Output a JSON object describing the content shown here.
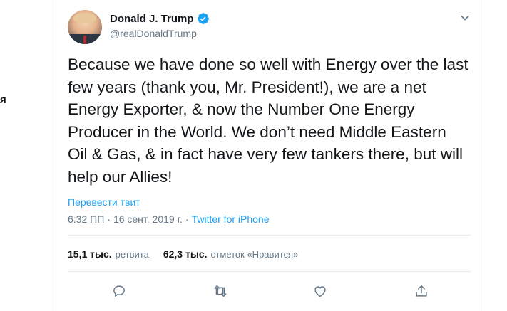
{
  "side": {
    "cropped_text": "я"
  },
  "tweet": {
    "author": {
      "name": "Donald J. Trump",
      "handle": "@realDonaldTrump",
      "verified_icon": "verified-badge-icon"
    },
    "text": "Because we have done so well with Energy over the last\nfew years (thank you, Mr. President!), we are a net\nEnergy Exporter, & now the Number One Energy\nProducer in the World. We don’t need Middle Eastern\nOil & Gas, & in fact have very few tankers there, but will\nhelp our Allies!",
    "translate_label": "Перевести твит",
    "time": "6:32 ПП",
    "date": "16 сент. 2019 г.",
    "separator": "·",
    "source": "Twitter for iPhone",
    "stats": {
      "retweets_count": "15,1 тыс.",
      "retweets_label": "ретвита",
      "likes_count": "62,3 тыс.",
      "likes_label": "отметок «Нравится»"
    },
    "actions": [
      "reply-icon",
      "retweet-icon",
      "like-icon",
      "share-icon"
    ]
  },
  "colors": {
    "accent": "#1da1f2",
    "text": "#14171a",
    "secondary": "#657786",
    "border": "#e6ecf0"
  }
}
